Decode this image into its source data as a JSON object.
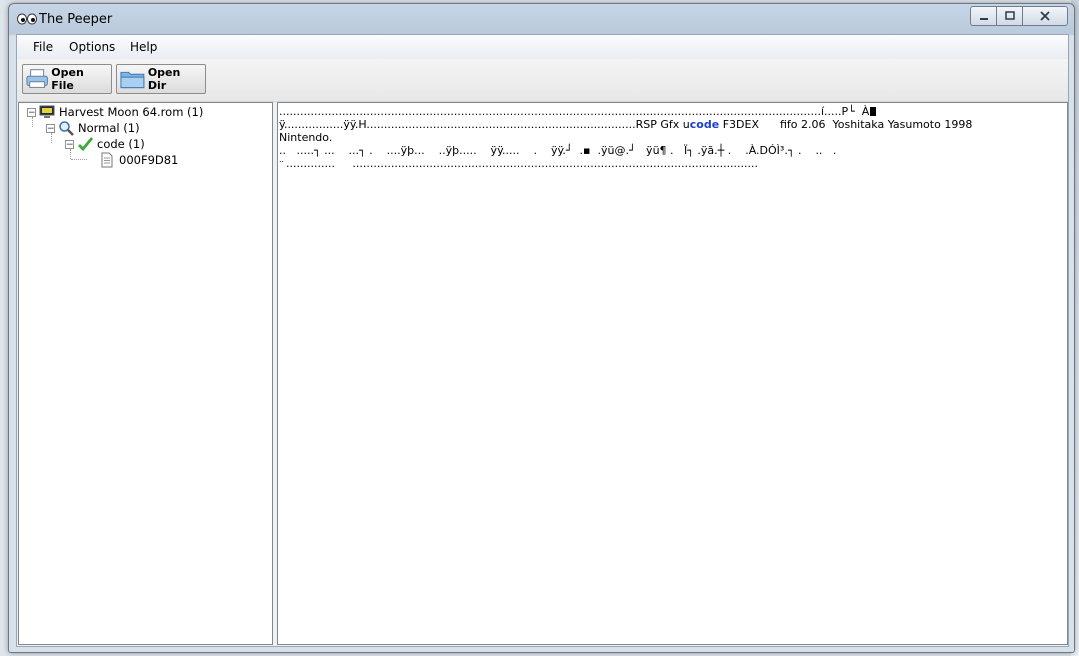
{
  "window": {
    "title": "The Peeper"
  },
  "menu": [
    "File",
    "Options",
    "Help"
  ],
  "toolbar": {
    "open_file": "Open File",
    "open_dir": "Open Dir"
  },
  "tree": {
    "root": "Harvest Moon 64.rom (1)",
    "normal": "Normal (1)",
    "code": "code (1)",
    "entry": "000F9D81"
  },
  "dump": {
    "line1": "...........................................................................................................................................................í.....P└  À",
    "line2a": "ÿ.................ÿÿ.H.............................................................................RSP Gfx u",
    "line2_highlight": "code",
    "line2b": " F3DEX      fifo 2.06  Yoshitaka Yasumoto 1998",
    "line3": "Nintendo.",
    "line4": "..   .....┐ ...    ...┐ .    ....ÿþ...    ..ÿþ.....    ÿÿ.....    .    ÿÿ.┘  .▪  .ÿü@.┘   ÿü¶ .   Ï┐ .ÿã.┼ .    .À.DÓÌ³.┐ .    ..   .",
    "line5": "..",
    "line6": "  ..............     ...................................................................................................................."
  },
  "colors": {
    "highlight": "#1a3fd0",
    "accent": "#4f9ad6"
  }
}
